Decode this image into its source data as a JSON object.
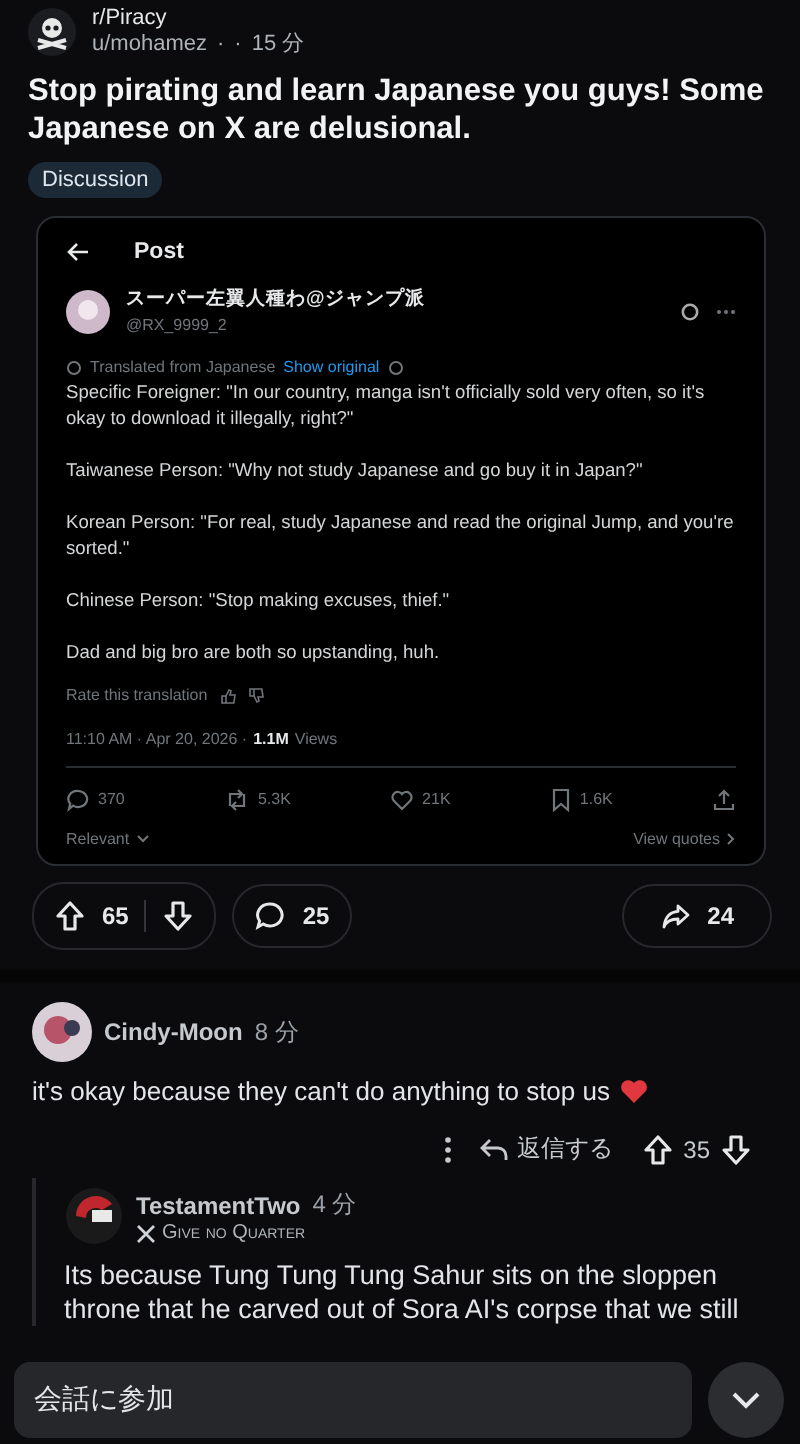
{
  "post": {
    "subreddit": "r/Piracy",
    "author": "u/mohamez",
    "separators": [
      "·",
      "·"
    ],
    "time": "15 分",
    "title": "Stop pirating and learn Japanese you guys! Some Japanese on X are delusional.",
    "flair": "Discussion"
  },
  "embed": {
    "header": "Post",
    "name": "スーパー左翼人種わ@ジャンプ派",
    "handle": "@RX_9999_2",
    "translated": "Translated from Japanese",
    "show_original": "Show original",
    "paragraphs": [
      "Specific Foreigner: \"In our country, manga isn't officially sold very often, so it's okay to download it illegally, right?\"",
      "Taiwanese Person: \"Why not study Japanese and go buy it in Japan?\"",
      "Korean Person: \"For real, study Japanese and read the original Jump, and you're sorted.\"",
      "Chinese Person: \"Stop making excuses, thief.\"",
      "Dad and big bro are both so upstanding, huh."
    ],
    "rate": "Rate this translation",
    "meta": "11:10 AM · Apr 20, 2026 ·",
    "views_count": "1.1M",
    "views_label": "Views",
    "stats": [
      {
        "kind": "reply",
        "value": "370"
      },
      {
        "kind": "repost",
        "value": "5.3K"
      },
      {
        "kind": "like",
        "value": "21K"
      },
      {
        "kind": "bookmark",
        "value": "1.6K"
      },
      {
        "kind": "share"
      }
    ],
    "relevant": "Relevant",
    "view_quotes": "View quotes"
  },
  "actions": {
    "upvotes": "65",
    "comments": "25",
    "shares": "24"
  },
  "comments": [
    {
      "kind": "top",
      "author": "Cindy-Moon",
      "time": "8 分",
      "text": "it's okay because they can't do anything to stop us",
      "reply": "返信する",
      "score": "35"
    },
    {
      "kind": "reply",
      "author": "TestamentTwo",
      "time": "4 分",
      "flair": "Give no Quarter",
      "text": "Its because Tung Tung Tung Sahur sits on the sloppen throne that he carved out of Sora AI's corpse that we still"
    }
  ],
  "composer": {
    "placeholder": "会話に参加"
  }
}
